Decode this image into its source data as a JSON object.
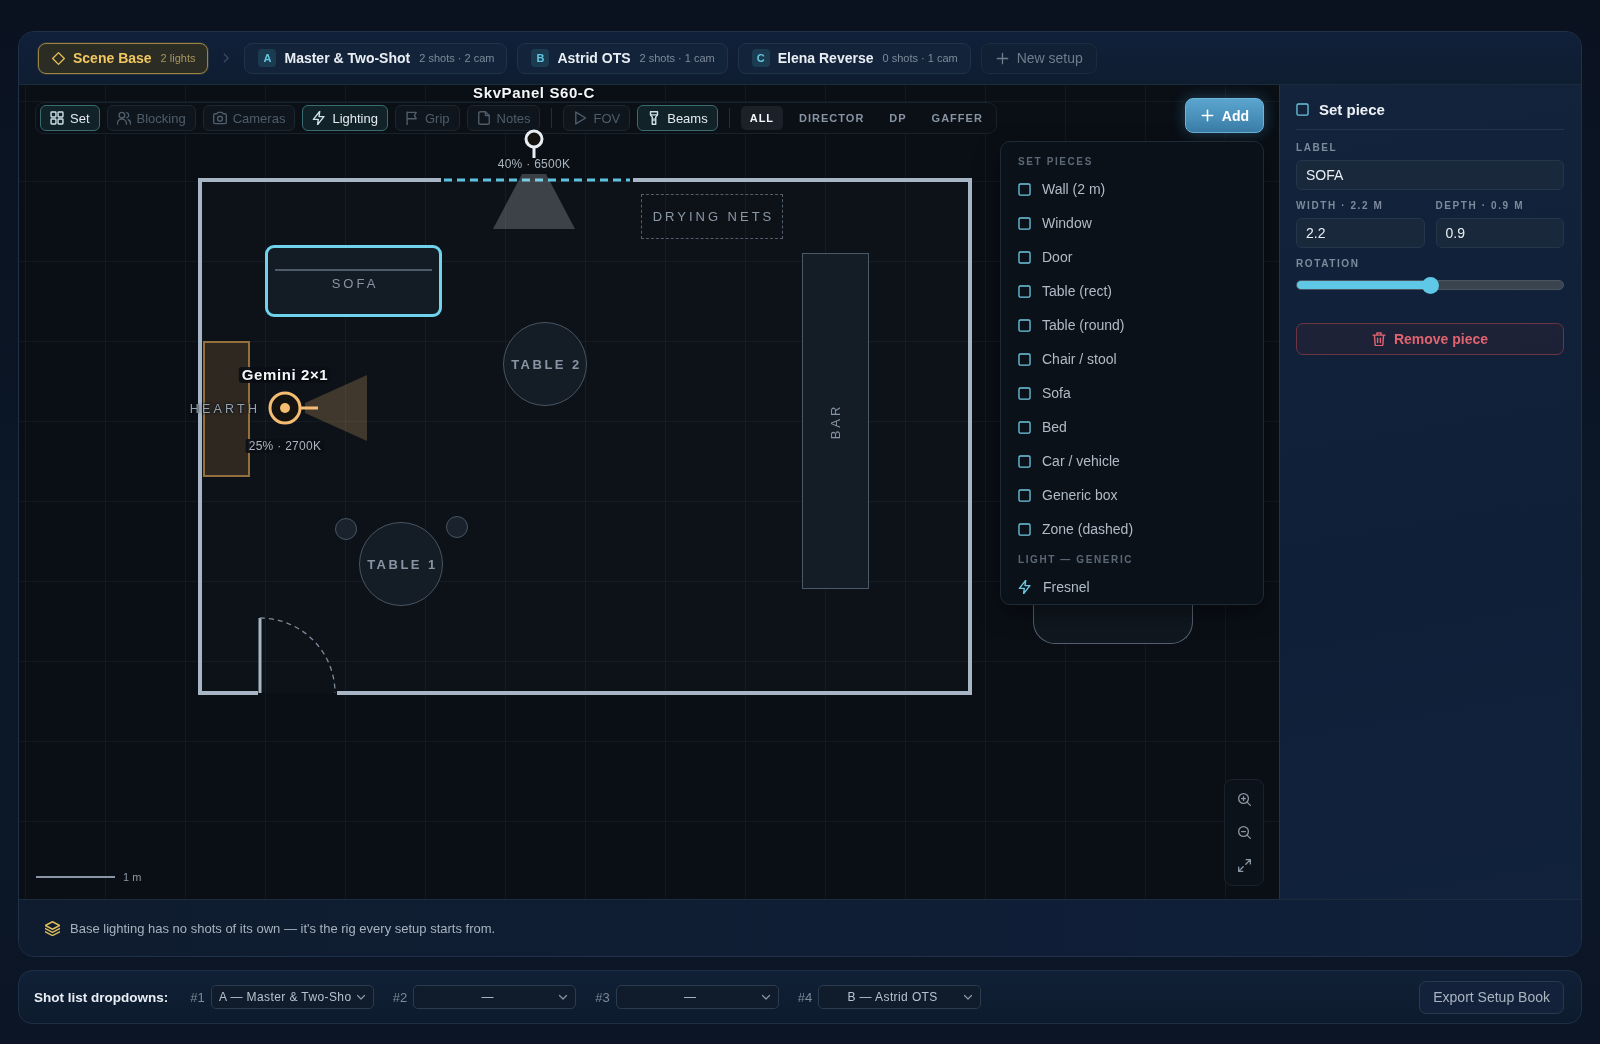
{
  "setup_tabs": [
    {
      "kind": "base",
      "label": "Scene Base",
      "meta": "2 lights",
      "selected": true
    },
    {
      "kind": "setup",
      "badge": "A",
      "label": "Master & Two-Shot",
      "meta": "2 shots · 2 cam",
      "selected": false
    },
    {
      "kind": "setup",
      "badge": "B",
      "label": "Astrid OTS",
      "meta": "2 shots · 1 cam",
      "selected": false
    },
    {
      "kind": "setup",
      "badge": "C",
      "label": "Elena Reverse",
      "meta": "0 shots · 1 cam",
      "selected": false
    }
  ],
  "new_setup_button": "New setup",
  "toolbar": {
    "layers": [
      {
        "kind": "set",
        "label": "Set",
        "on": true
      },
      {
        "kind": "blocking",
        "label": "Blocking",
        "on": false
      },
      {
        "kind": "cameras",
        "label": "Cameras",
        "on": false
      },
      {
        "kind": "lighting",
        "label": "Lighting",
        "on": true
      },
      {
        "kind": "grip",
        "label": "Grip",
        "on": false
      },
      {
        "kind": "notes",
        "label": "Notes",
        "on": false
      }
    ],
    "overlays": [
      {
        "kind": "fov",
        "label": "FOV",
        "on": false
      },
      {
        "kind": "beams",
        "label": "Beams",
        "on": true
      }
    ],
    "roles": [
      {
        "label": "ALL",
        "selected": true
      },
      {
        "label": "DIRECTOR",
        "selected": false
      },
      {
        "label": "DP",
        "selected": false
      },
      {
        "label": "GAFFER",
        "selected": false
      }
    ]
  },
  "canvas": {
    "pieces": [
      {
        "kind": "sofa",
        "label": "SOFA",
        "selected": true
      },
      {
        "kind": "zone",
        "label": "DRYING NETS",
        "selected": false
      },
      {
        "kind": "round_table",
        "label": "TABLE 2",
        "selected": false
      },
      {
        "kind": "counter",
        "label": "BAR",
        "selected": false
      },
      {
        "kind": "hearth",
        "label": "HEARTH",
        "selected": false
      },
      {
        "kind": "round_table",
        "label": "TABLE 1",
        "selected": false
      },
      {
        "kind": "stool",
        "selected": false
      },
      {
        "kind": "stool",
        "selected": false
      },
      {
        "kind": "box",
        "selected": false
      }
    ],
    "lights": [
      {
        "name": "SkvPanel S60-C",
        "reading": "40% · 6500K",
        "color": "#e8eef3"
      },
      {
        "name": "Gemini 2×1",
        "reading": "25% · 2700K",
        "color": "#f5bd72"
      }
    ],
    "scale_label": "1 m"
  },
  "add_menu": {
    "button": "Add",
    "sections": [
      {
        "title": "SET PIECES",
        "items": [
          {
            "kind": "piece",
            "label": "Wall (2 m)"
          },
          {
            "kind": "piece",
            "label": "Window"
          },
          {
            "kind": "piece",
            "label": "Door"
          },
          {
            "kind": "piece",
            "label": "Table (rect)"
          },
          {
            "kind": "piece",
            "label": "Table (round)"
          },
          {
            "kind": "piece",
            "label": "Chair / stool"
          },
          {
            "kind": "piece",
            "label": "Sofa"
          },
          {
            "kind": "piece",
            "label": "Bed"
          },
          {
            "kind": "piece",
            "label": "Car / vehicle"
          },
          {
            "kind": "piece",
            "label": "Generic box"
          },
          {
            "kind": "piece",
            "label": "Zone (dashed)"
          }
        ]
      },
      {
        "title": "LIGHT — GENERIC",
        "items": [
          {
            "kind": "light",
            "label": "Fresnel"
          }
        ]
      }
    ]
  },
  "inspector": {
    "title": "Set piece",
    "label_field": {
      "label": "LABEL",
      "value": "SOFA"
    },
    "width_field": {
      "label": "WIDTH · 2.2 M",
      "value": "2.2"
    },
    "depth_field": {
      "label": "DEPTH · 0.9 M",
      "value": "0.9"
    },
    "rotation": {
      "label": "ROTATION",
      "level": 0.5
    },
    "remove_button": "Remove piece"
  },
  "info_bar": "Base lighting has no shots of its own — it's the rig every setup starts from.",
  "shot_list": {
    "label": "Shot list dropdowns:",
    "slots": [
      {
        "number": "#1",
        "value": "A — Master & Two-Sho"
      },
      {
        "number": "#2",
        "value": "—"
      },
      {
        "number": "#3",
        "value": "—"
      },
      {
        "number": "#4",
        "value": "B — Astrid OTS"
      }
    ],
    "export_button": "Export Setup Book"
  }
}
